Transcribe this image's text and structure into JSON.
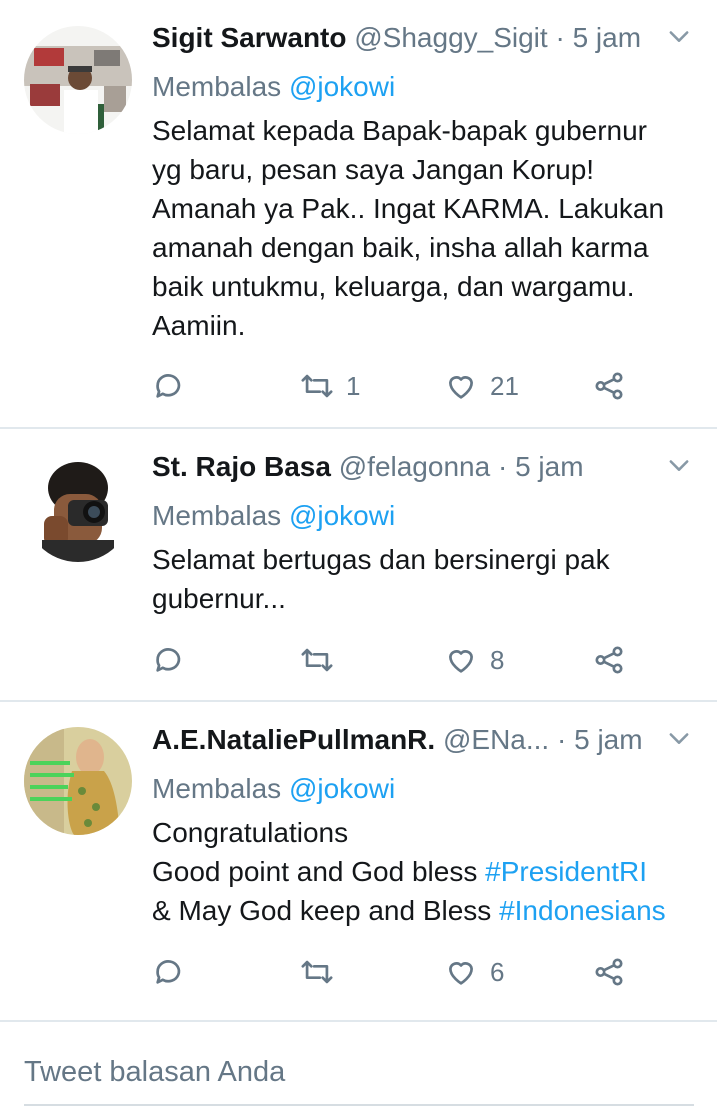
{
  "tweets": [
    {
      "name": "Sigit Sarwanto",
      "handle": "@Shaggy_Sigit",
      "separator": "·",
      "time": "5 jam",
      "replying_prefix": "Membalas",
      "replying_to": "@jokowi",
      "lines": [
        "Selamat kepada Bapak-bapak gubernur",
        "yg baru, pesan saya Jangan Korup!",
        "Amanah ya Pak.. Ingat KARMA. Lakukan",
        "amanah dengan baik, insha allah karma",
        "baik untukmu, keluarga, dan wargamu.",
        "Aamiin."
      ],
      "retweets": "1",
      "likes": "21"
    },
    {
      "name": "St. Rajo Basa",
      "handle": "@felagonna",
      "separator": "·",
      "time": "5 jam",
      "replying_prefix": "Membalas",
      "replying_to": "@jokowi",
      "lines": [
        "Selamat bertugas dan bersinergi pak",
        "gubernur..."
      ],
      "retweets": "",
      "likes": "8"
    },
    {
      "name": "A.E.NataliePullmanR.",
      "handle": "@ENa...",
      "separator": "·",
      "time": "5 jam",
      "replying_prefix": "Membalas",
      "replying_to": "@jokowi",
      "line1": "Congratulations",
      "line2_text": "Good point and God bless ",
      "line2_tag": "#PresidentRI",
      "line3_text": "& May God keep and Bless ",
      "line3_tag": "#Indonesians",
      "retweets": "",
      "likes": "6"
    }
  ],
  "compose": {
    "placeholder": "Tweet balasan Anda"
  },
  "icons": {
    "reply": "reply-icon",
    "retweet": "retweet-icon",
    "like": "heart-icon",
    "share": "share-icon",
    "more": "chevron-down-icon"
  },
  "colors": {
    "link": "#1da1f2",
    "secondary_text": "#657786",
    "primary_text": "#14171a",
    "divider": "#e1e8ed"
  }
}
